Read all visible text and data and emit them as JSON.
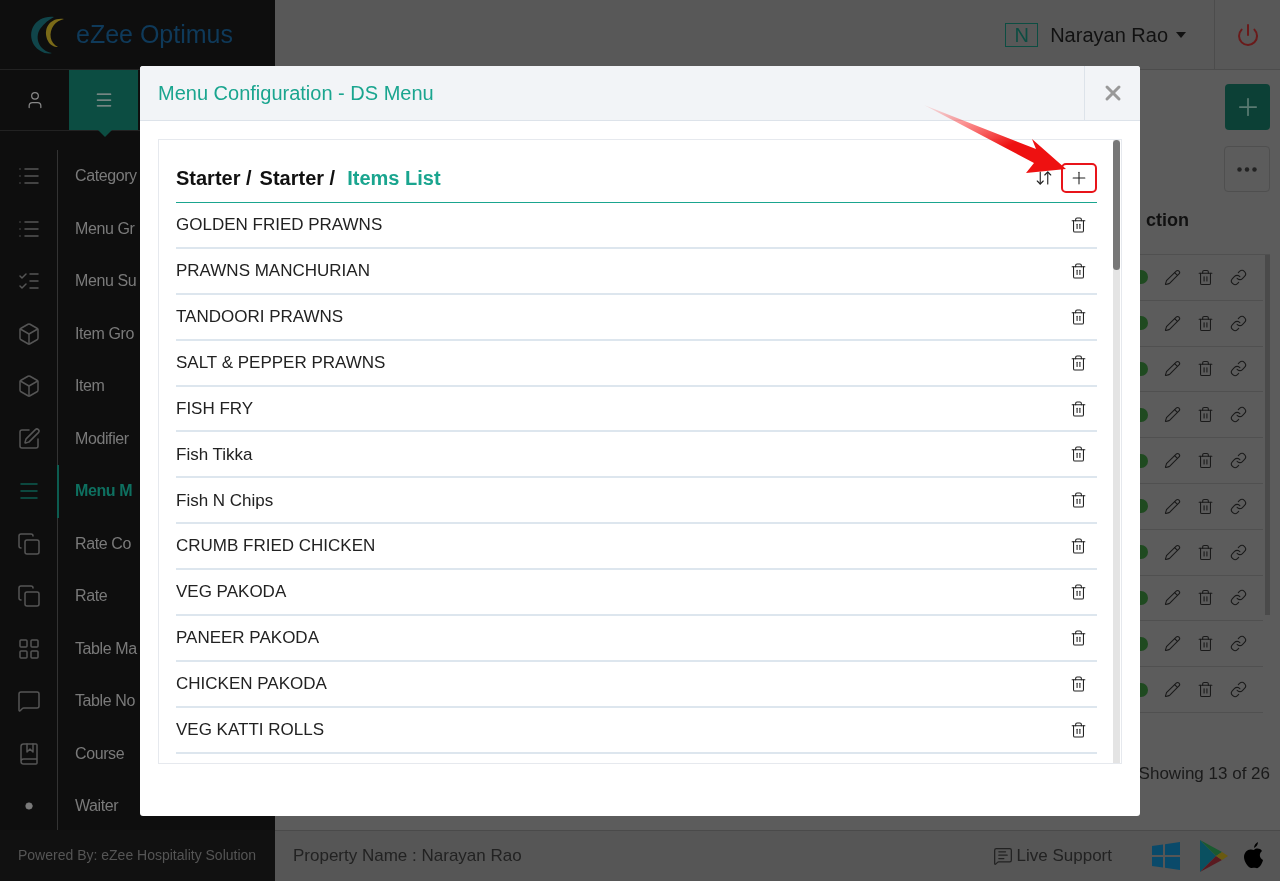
{
  "brand": {
    "logo": "eZee Optimus"
  },
  "sidebar": {
    "tabs": [
      {
        "kind": "user",
        "selected": false
      },
      {
        "kind": "menu",
        "selected": true
      }
    ],
    "items": [
      {
        "kind": "list",
        "label": "Category",
        "selected": false
      },
      {
        "kind": "bullets",
        "label": "Menu Gr",
        "selected": false
      },
      {
        "kind": "sublist",
        "label": "Menu Su",
        "selected": false
      },
      {
        "kind": "box",
        "label": "Item Gro",
        "selected": false
      },
      {
        "kind": "box",
        "label": "Item",
        "selected": false
      },
      {
        "kind": "edit",
        "label": "Modifier",
        "selected": false
      },
      {
        "kind": "menu",
        "label": "Menu M",
        "selected": true
      },
      {
        "kind": "copy",
        "label": "Rate Co",
        "selected": false
      },
      {
        "kind": "copy",
        "label": "Rate",
        "selected": false
      },
      {
        "kind": "grid",
        "label": "Table Ma",
        "selected": false
      },
      {
        "kind": "chat",
        "label": "Table No",
        "selected": false
      },
      {
        "kind": "book",
        "label": "Course",
        "selected": false
      },
      {
        "kind": "dot",
        "label": "Waiter",
        "selected": false
      }
    ],
    "footer": "Powered By: eZee Hospitality Solution"
  },
  "header": {
    "avatar": "N",
    "user": "Narayan Rao"
  },
  "table": {
    "column_header": "ction",
    "rows": [
      {
        "color": "#1f4a20"
      },
      {
        "color": "#1f4a20"
      },
      {
        "color": "#1f4a20"
      },
      {
        "color": "#1f4a20"
      },
      {
        "color": "#1f4a20"
      },
      {
        "color": "#1f4a20"
      },
      {
        "color": "#1f4a20"
      },
      {
        "color": "#1f4a20"
      },
      {
        "color": "#1f4a20"
      },
      {
        "color": "#1f4a20"
      }
    ],
    "pagination": "Showing 13 of 26"
  },
  "status_bar": {
    "property": "Property Name : Narayan Rao",
    "live_support": "Live Support"
  },
  "modal": {
    "title": "Menu Configuration - DS Menu",
    "breadcrumb": [
      {
        "label": "Starter /",
        "selected": false
      },
      {
        "label": "Starter /",
        "selected": false
      },
      {
        "label": "Items List",
        "selected": true
      }
    ],
    "items": [
      "GOLDEN FRIED PRAWNS",
      "PRAWNS MANCHURIAN",
      "TANDOORI PRAWNS",
      "SALT & PEPPER PRAWNS",
      "FISH FRY",
      "Fish Tikka",
      "Fish N Chips",
      "CRUMB FRIED CHICKEN",
      "VEG PAKODA",
      "PANEER PAKODA",
      "CHICKEN PAKODA",
      "VEG KATTI ROLLS"
    ]
  }
}
